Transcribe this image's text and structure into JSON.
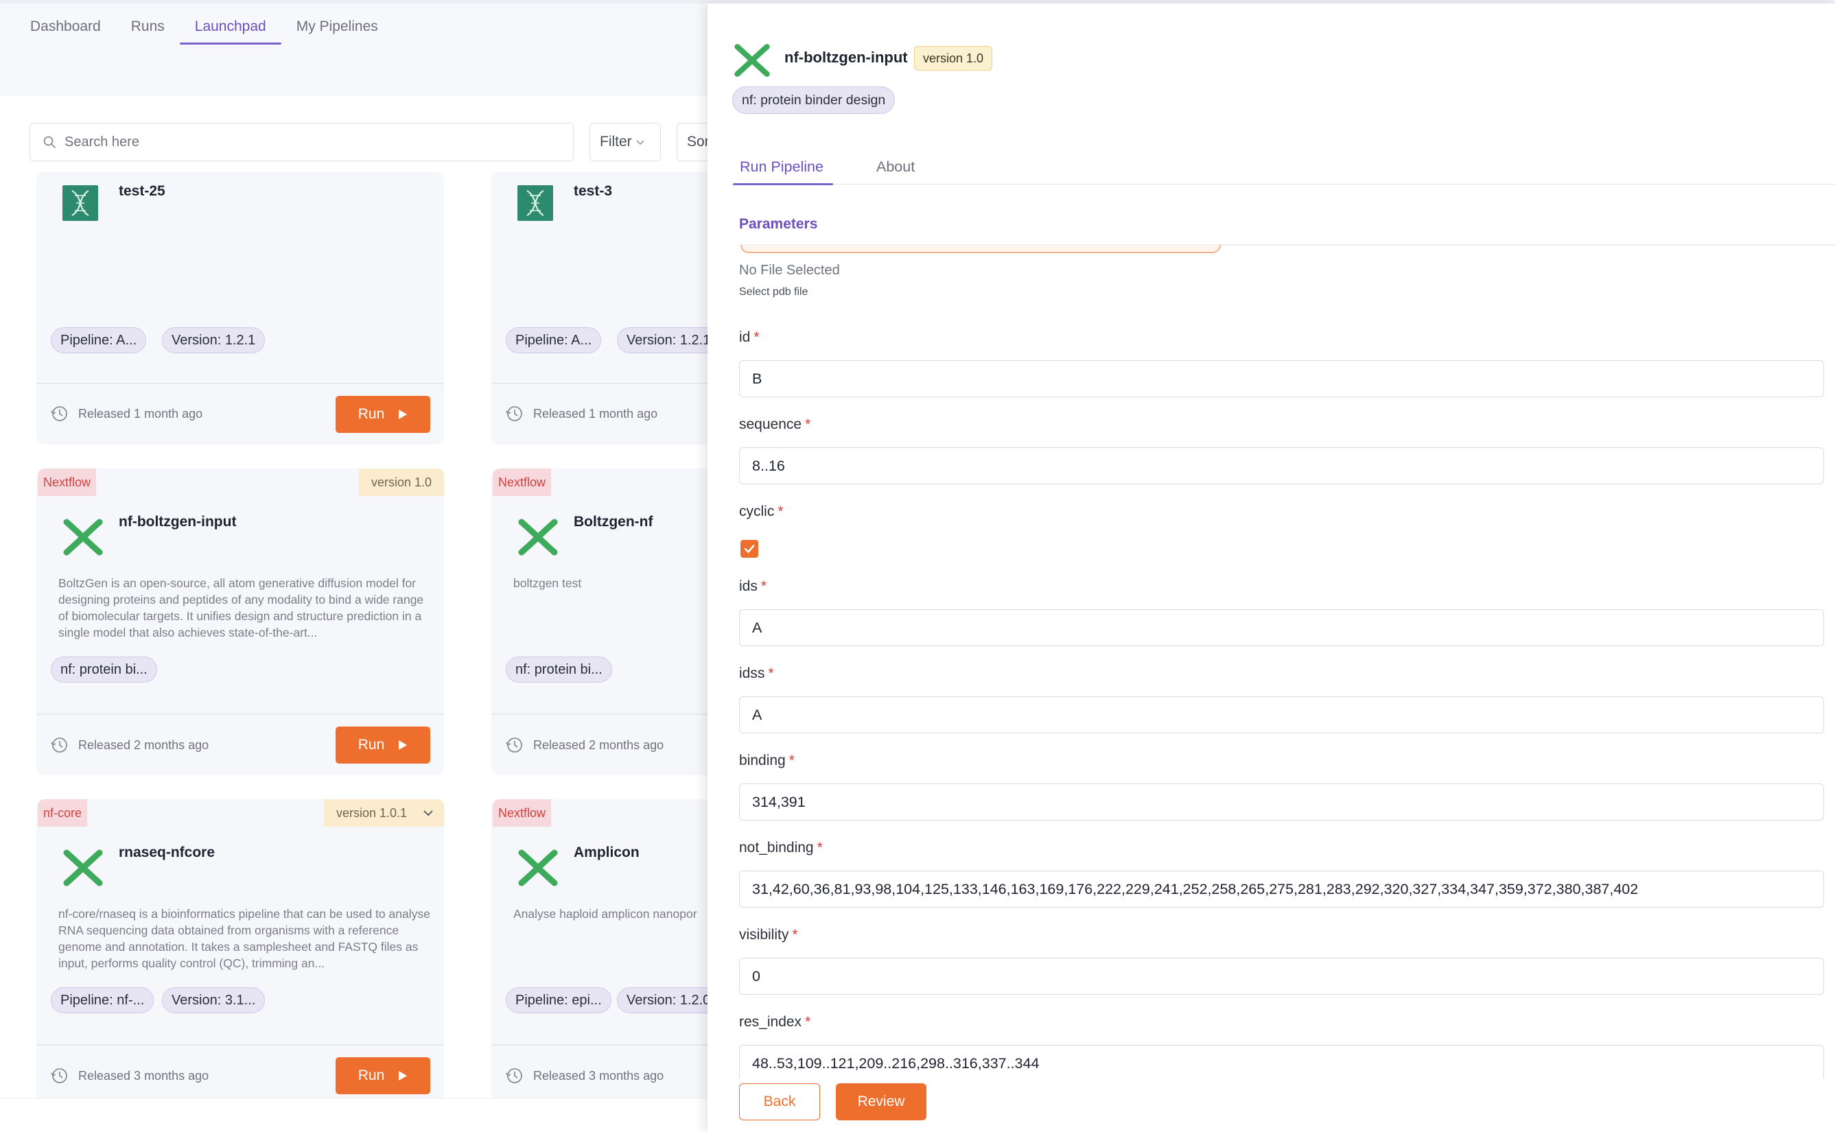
{
  "nav": {
    "tabs": [
      "Dashboard",
      "Runs",
      "Launchpad",
      "My Pipelines"
    ],
    "active": "Launchpad"
  },
  "search": {
    "placeholder": "Search here"
  },
  "toolbar": {
    "filter_label": "Filter",
    "sort_label": "Sor"
  },
  "cards": [
    {
      "title": "test-25",
      "pill1": "Pipeline: A...",
      "pill2": "Version: 1.2.1",
      "released": "Released 1 month ago",
      "run_label": "Run"
    },
    {
      "title": "test-3",
      "pill1": "Pipeline: A...",
      "pill2": "Version: 1.2.1",
      "released": "Released 1 month ago"
    },
    {
      "type": "Nextflow",
      "version": "version 1.0",
      "title": "nf-boltzgen-input",
      "description": "BoltzGen is an open-source, all atom generative diffusion model for designing proteins and peptides of any modality to bind a wide range of biomolecular targets. It unifies design and structure prediction in a single model that also achieves state-of-the-art...",
      "pill1": "nf: protein bi...",
      "released": "Released 2 months ago",
      "run_label": "Run"
    },
    {
      "type": "Nextflow",
      "title": "Boltzgen-nf",
      "description": "boltzgen test",
      "pill1": "nf: protein bi...",
      "released": "Released 2 months ago"
    },
    {
      "type": "nf-core",
      "version": "version 1.0.1",
      "title": "rnaseq-nfcore",
      "description": "nf-core/rnaseq is a bioinformatics pipeline that can be used to analyse RNA sequencing data obtained from organisms with a reference genome and annotation. It takes a samplesheet and FASTQ files as input, performs quality control (QC), trimming an...",
      "pill1": "Pipeline: nf-...",
      "pill2": "Version: 3.1...",
      "released": "Released 3 months ago",
      "run_label": "Run"
    },
    {
      "type": "Nextflow",
      "title": "Amplicon",
      "description": "Analyse haploid amplicon nanopor",
      "pill1": "Pipeline: epi...",
      "pill2": "Version: 1.2.0",
      "released": "Released 3 months ago"
    }
  ],
  "drawer": {
    "name": "nf-boltzgen-input",
    "version": "version 1.0",
    "chip": "nf: protein binder design",
    "tabs": [
      "Run Pipeline",
      "About"
    ],
    "section": "Parameters",
    "no_file": "No File Selected",
    "select_hint": "Select pdb file",
    "fields": {
      "id": {
        "label": "id",
        "value": "B"
      },
      "sequence": {
        "label": "sequence",
        "value": "8..16"
      },
      "cyclic": {
        "label": "cyclic",
        "checked": true
      },
      "ids": {
        "label": "ids",
        "value": "A"
      },
      "idss": {
        "label": "idss",
        "value": "A"
      },
      "binding": {
        "label": "binding",
        "value": "314,391"
      },
      "not_binding": {
        "label": "not_binding",
        "value": "31,42,60,36,81,93,98,104,125,133,146,163,169,176,222,229,241,252,258,265,275,281,283,292,320,327,334,347,359,372,380,387,402"
      },
      "visibility": {
        "label": "visibility",
        "value": "0"
      },
      "res_index": {
        "label": "res_index",
        "value": "48..53,109..121,209..216,298..316,337..344"
      }
    },
    "required_mark": "*",
    "back_label": "Back",
    "review_label": "Review"
  },
  "colors": {
    "accent": "#ee6f2d",
    "purple": "#6a4fbf",
    "nextflow_green": "#3daa5c"
  }
}
